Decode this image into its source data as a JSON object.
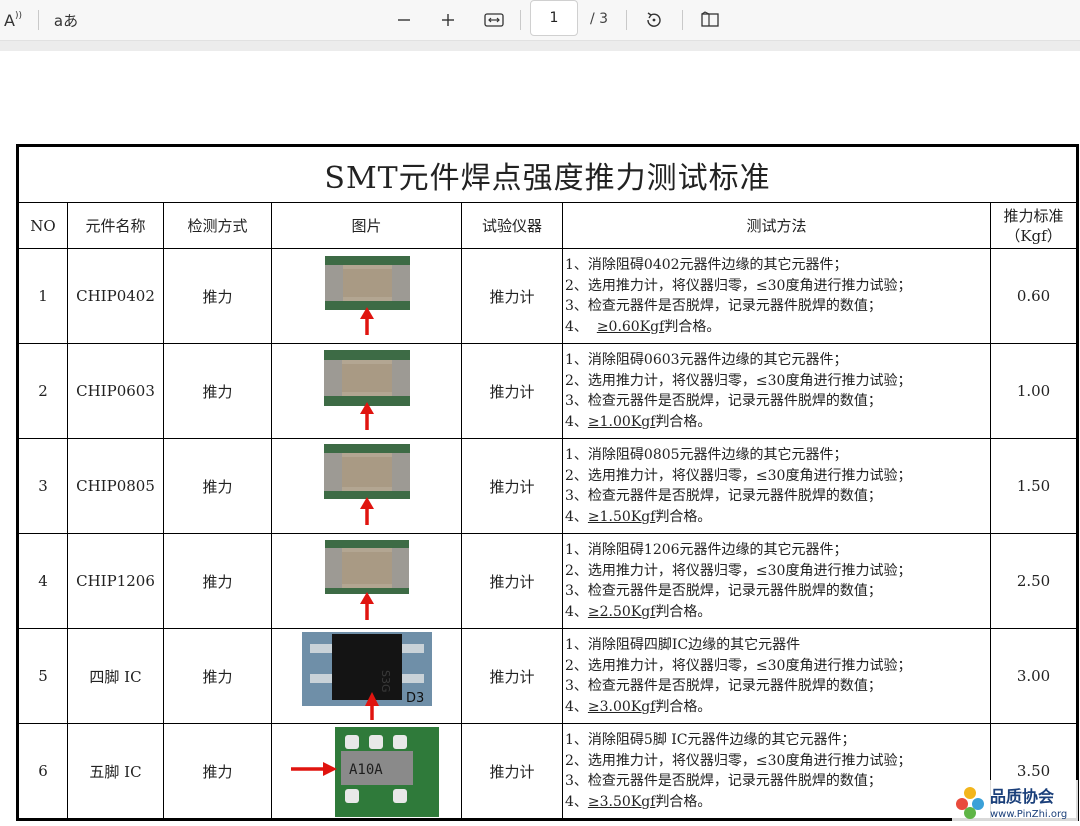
{
  "toolbar": {
    "read_aloud_label": "A",
    "translate_label": "aあ",
    "page_current": "1",
    "page_total": "/ 3"
  },
  "document": {
    "title": "SMT元件焊点强度推力测试标准",
    "headers": {
      "no": "NO",
      "name": "元件名称",
      "method": "检测方式",
      "picture": "图片",
      "instrument": "试验仪器",
      "test_method": "测试方法",
      "standard_line1": "推力标准",
      "standard_line2": "（Kgf）"
    },
    "rows": [
      {
        "no": "1",
        "name": "CHIP0402",
        "method": "推力",
        "instrument": "推力计",
        "std": "0.60",
        "m1": "1、消除阻碍0402元器件边缘的其它元器件；",
        "m2": "2、选用推力计，将仪器归零，≤30度角进行推力试验；",
        "m3": "3、检查元器件是否脱焊，记录元器件脱焊的数值；",
        "m4_pre": "4、  ",
        "m4_u": "≥0.60Kgf",
        "m4_post": "判合格。"
      },
      {
        "no": "2",
        "name": "CHIP0603",
        "method": "推力",
        "instrument": "推力计",
        "std": "1.00",
        "m1": "1、消除阻碍0603元器件边缘的其它元器件；",
        "m2": "2、选用推力计，将仪器归零，≤30度角进行推力试验；",
        "m3": "3、检查元器件是否脱焊，记录元器件脱焊的数值；",
        "m4_pre": "4、",
        "m4_u": "≥1.00Kgf",
        "m4_post": "判合格。"
      },
      {
        "no": "3",
        "name": "CHIP0805",
        "method": "推力",
        "instrument": "推力计",
        "std": "1.50",
        "m1": "1、消除阻碍0805元器件边缘的其它元器件；",
        "m2": "2、选用推力计，将仪器归零，≤30度角进行推力试验；",
        "m3": "3、检查元器件是否脱焊，记录元器件脱焊的数值；",
        "m4_pre": "4、",
        "m4_u": "≥1.50Kgf",
        "m4_post": "判合格。"
      },
      {
        "no": "4",
        "name": "CHIP1206",
        "method": "推力",
        "instrument": "推力计",
        "std": "2.50",
        "m1": "1、消除阻碍1206元器件边缘的其它元器件；",
        "m2": "2、选用推力计，将仪器归零，≤30度角进行推力试验；",
        "m3": "3、检查元器件是否脱焊，记录元器件脱焊的数值；",
        "m4_pre": "4、",
        "m4_u": "≥2.50Kgf",
        "m4_post": "判合格。"
      },
      {
        "no": "5",
        "name": "四脚 IC",
        "method": "推力",
        "instrument": "推力计",
        "std": "3.00",
        "m1": "1、消除阻碍四脚IC边缘的其它元器件",
        "m2": "2、选用推力计，将仪器归零，≤30度角进行推力试验；",
        "m3": "3、检查元器件是否脱焊，记录元器件脱焊的数值；",
        "m4_pre": "4、",
        "m4_u": "≥3.00Kgf",
        "m4_post": "判合格。"
      },
      {
        "no": "6",
        "name": "五脚 IC",
        "method": "推力",
        "instrument": "推力计",
        "std": "3.50",
        "m1": "1、消除阻碍5脚 IC元器件边缘的其它元器件；",
        "m2": "2、选用推力计，将仪器归零，≤30度角进行推力试验；",
        "m3": "3、检查元器件是否脱焊，记录元器件脱焊的数值；",
        "m4_pre": "4、",
        "m4_u": "≥3.50Kgf",
        "m4_post": "判合格。"
      }
    ],
    "photo_labels": {
      "ic4_marking": "D3",
      "ic4_chip_text": "S3G",
      "ic5_chip_text": "A10A"
    }
  },
  "watermark": {
    "name": "品质协会",
    "url": "www.PinZhi.org"
  },
  "colors": {
    "arrow": "#e0140f",
    "board_green": "#2f7a3a",
    "board_blue": "#6f8fa8"
  }
}
